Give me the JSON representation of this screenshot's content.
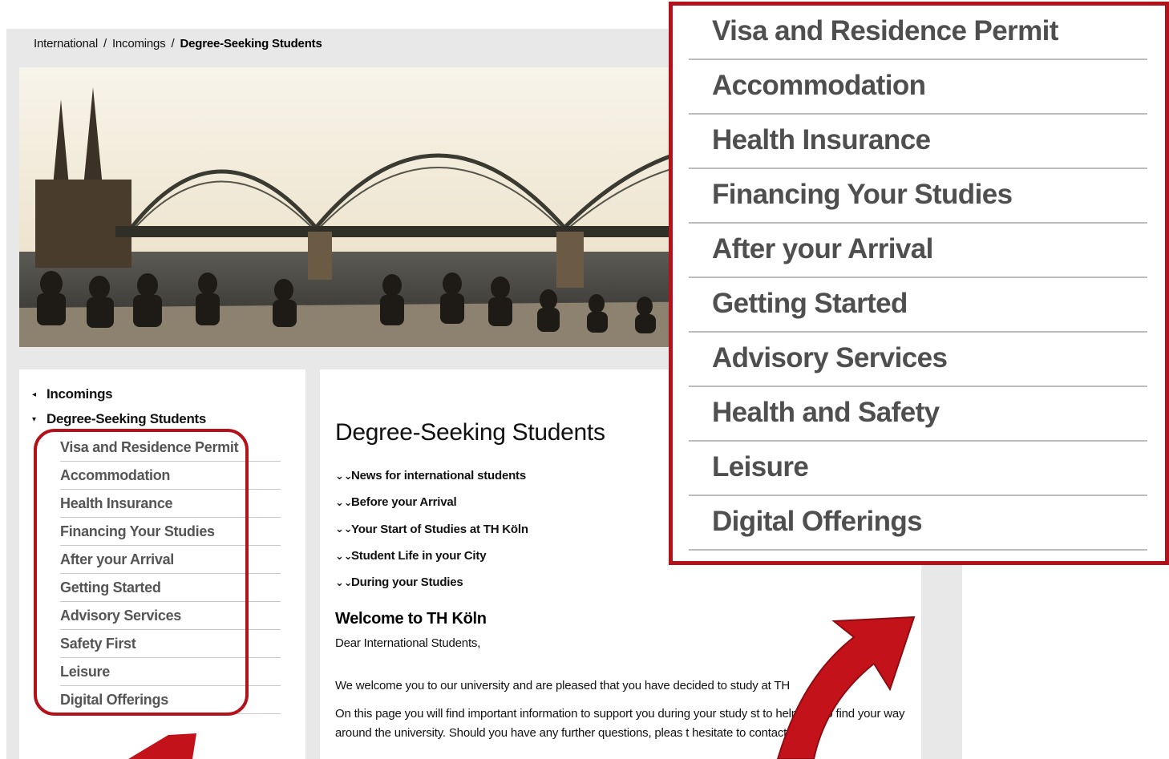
{
  "breadcrumb": {
    "items": [
      "International",
      "Incomings"
    ],
    "separator": "/",
    "current": "Degree-Seeking Students"
  },
  "sidebar": {
    "parent_label": "Incomings",
    "active_label": "Degree-Seeking Students",
    "items": [
      "Visa and Residence Permit",
      "Accommodation",
      "Health Insurance",
      "Financing Your Studies",
      "After your Arrival",
      "Getting Started",
      "Advisory Services",
      "Safety First",
      "Leisure",
      "Digital Offerings"
    ]
  },
  "content": {
    "title": "Degree-Seeking Students",
    "jump_links": [
      "News for international students",
      "Before your Arrival",
      "Your Start of Studies at TH Köln",
      "Student Life in your City",
      "During your Studies"
    ],
    "welcome_heading": "Welcome to TH Köln",
    "greeting": "Dear International Students,",
    "paragraph1": "We welcome you to our university and are pleased that you have decided to study at TH",
    "paragraph2": "On this page you will find important information to support you during your study st          to help you to find your way around the university. Should you have any further questions, pleas      t hesitate to contact us."
  },
  "zoom_panel": {
    "items": [
      "Visa and Residence Permit",
      "Accommodation",
      "Health Insurance",
      "Financing Your Studies",
      "After your Arrival",
      "Getting Started",
      "Advisory Services",
      "Health and Safety",
      "Leisure",
      "Digital Offerings"
    ]
  },
  "colors": {
    "accent_red": "#b4121a",
    "page_gray": "#e8e8e8",
    "nav_text": "#555555"
  },
  "icons": {
    "back_caret": "◂",
    "open_caret": "▾",
    "jump_chevron": "⌄⌄"
  }
}
